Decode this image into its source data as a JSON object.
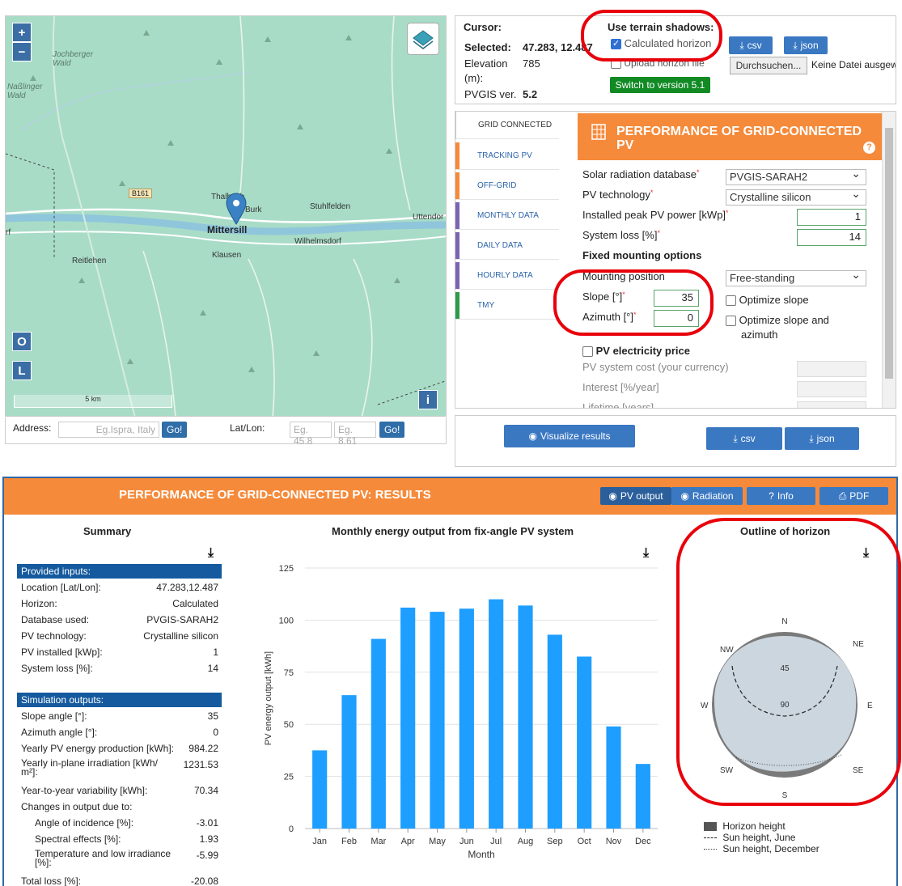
{
  "map": {
    "zoom_in": "+",
    "zoom_out": "−",
    "btn_o": "O",
    "btn_l": "L",
    "btn_i": "i",
    "scale": "5 km",
    "road": "B161",
    "towns": {
      "jochberger": "Jochberger\nWald",
      "nasslinger": "Naßlinger\nWald",
      "thalbach": "Thalbach",
      "burk": "Burk",
      "stuhlfelden": "Stuhlfelden",
      "uttendorf": "Uttendor",
      "mittersill": "Mittersill",
      "wilhelmsdorf": "Wilhelmsdorf",
      "reitlehen": "Reitlehen",
      "klausen": "Klausen",
      "rf": "rf"
    }
  },
  "search": {
    "address_label": "Address:",
    "address_placeholder": "Eg.Ispra, Italy",
    "go": "Go!",
    "latlon_label": "Lat/Lon:",
    "lat_placeholder": "Eg. 45.8",
    "lon_placeholder": "Eg. 8.61"
  },
  "info": {
    "cursor_label": "Cursor:",
    "selected_label": "Selected:",
    "selected_value": "47.283, 12.487",
    "elevation_label": "Elevation",
    "elevation_unit": "(m):",
    "elevation_value": "785",
    "version_label": "PVGIS ver.",
    "version_value": "5.2",
    "terrain_title": "Use terrain shadows:",
    "calculated_horizon": "Calculated horizon",
    "upload_horizon": "Upload horizon file",
    "csv": "csv",
    "json": "json",
    "browse": "Durchsuchen...",
    "no_file": "Keine Datei ausgew",
    "switch_version": "Switch to version 5.1"
  },
  "tabs": [
    "GRID CONNECTED",
    "TRACKING PV",
    "OFF-GRID",
    "MONTHLY DATA",
    "DAILY DATA",
    "HOURLY DATA",
    "TMY"
  ],
  "tab_colors": [
    "#ffffff",
    "#f58a3a",
    "#f58a3a",
    "#7b63b4",
    "#7b63b4",
    "#7b63b4",
    "#2e9b4a"
  ],
  "perf": {
    "title": "PERFORMANCE OF GRID-CONNECTED PV",
    "help": "?",
    "solar_db_label": "Solar radiation database",
    "solar_db_value": "PVGIS-SARAH2",
    "pv_tech_label": "PV technology",
    "pv_tech_value": "Crystalline silicon",
    "peak_label": "Installed peak PV power [kWp]",
    "peak_value": "1",
    "loss_label": "System loss [%]",
    "loss_value": "14",
    "fixed_title": "Fixed mounting options",
    "mount_label": "Mounting position",
    "mount_value": "Free-standing",
    "slope_label": "Slope [°]",
    "slope_value": "35",
    "azimuth_label": "Azimuth [°]",
    "azimuth_value": "0",
    "opt_slope": "Optimize slope",
    "opt_both": "Optimize slope and",
    "opt_both2": "azimuth",
    "price_title": "PV electricity price",
    "cost_label": "PV system cost (your currency)",
    "interest_label": "Interest [%/year]",
    "lifetime_label": "Lifetime [years]",
    "star": "*"
  },
  "actions": {
    "visualize": "Visualize results",
    "csv": "csv",
    "json": "json"
  },
  "results": {
    "title": "PERFORMANCE OF GRID-CONNECTED PV: RESULTS",
    "pv_output": "PV output",
    "radiation": "Radiation",
    "info": "Info",
    "pdf": "PDF",
    "summary_title": "Summary",
    "chart_title": "Monthly energy output from fix-angle PV system",
    "horizon_title": "Outline of horizon",
    "provided_inputs": "Provided inputs:",
    "inputs": [
      {
        "k": "Location [Lat/Lon]:",
        "v": "47.283,12.487"
      },
      {
        "k": "Horizon:",
        "v": "Calculated"
      },
      {
        "k": "Database used:",
        "v": "PVGIS-SARAH2"
      },
      {
        "k": "PV technology:",
        "v": "Crystalline silicon"
      },
      {
        "k": "PV installed [kWp]:",
        "v": "1"
      },
      {
        "k": "System loss [%]:",
        "v": "14"
      }
    ],
    "simulation_outputs": "Simulation outputs:",
    "outputs": [
      {
        "k": "Slope angle [°]:",
        "v": "35"
      },
      {
        "k": "Azimuth angle [°]:",
        "v": "0"
      },
      {
        "k": "Yearly PV energy production [kWh]:",
        "v": "984.22"
      },
      {
        "k": "Yearly in-plane irradiation [kWh/",
        "k2": "m²]:",
        "v": "1231.53"
      },
      {
        "k": "Year-to-year variability [kWh]:",
        "v": "70.34"
      },
      {
        "k": "Changes in output due to:",
        "v": ""
      }
    ],
    "changes": [
      {
        "k": "Angle of incidence [%]:",
        "v": "-3.01"
      },
      {
        "k": "Spectral effects [%]:",
        "v": "1.93"
      },
      {
        "k": "Temperature and low irradiance",
        "k2": "[%]:",
        "v": "-5.99"
      }
    ],
    "total_loss_label": "Total loss [%]:",
    "total_loss_value": "-20.08",
    "horizon_legend": [
      "Horizon height",
      "Sun height, June",
      "Sun height, December"
    ],
    "compass": {
      "n": "N",
      "ne": "NE",
      "e": "E",
      "se": "SE",
      "s": "S",
      "sw": "SW",
      "w": "W",
      "nw": "NW",
      "r45": "45",
      "r90": "90"
    }
  },
  "chart_data": {
    "type": "bar",
    "title": "Monthly energy output from fix-angle PV system",
    "xlabel": "Month",
    "ylabel": "PV energy output [kWh]",
    "categories": [
      "Jan",
      "Feb",
      "Mar",
      "Apr",
      "May",
      "Jun",
      "Jul",
      "Aug",
      "Sep",
      "Oct",
      "Nov",
      "Dec"
    ],
    "values": [
      37.5,
      64,
      91,
      106,
      104,
      105.5,
      110,
      107,
      93,
      82.5,
      49,
      31
    ],
    "ylim": [
      0,
      125
    ],
    "yticks": [
      0,
      25,
      50,
      75,
      100,
      125
    ],
    "color": "#1e9eff",
    "grid": true
  },
  "colors": {
    "orange": "#f58a3a",
    "blue": "#155a9e",
    "button_blue": "#3a78c2",
    "green": "#118a24",
    "annotation_red": "#e8000b"
  }
}
